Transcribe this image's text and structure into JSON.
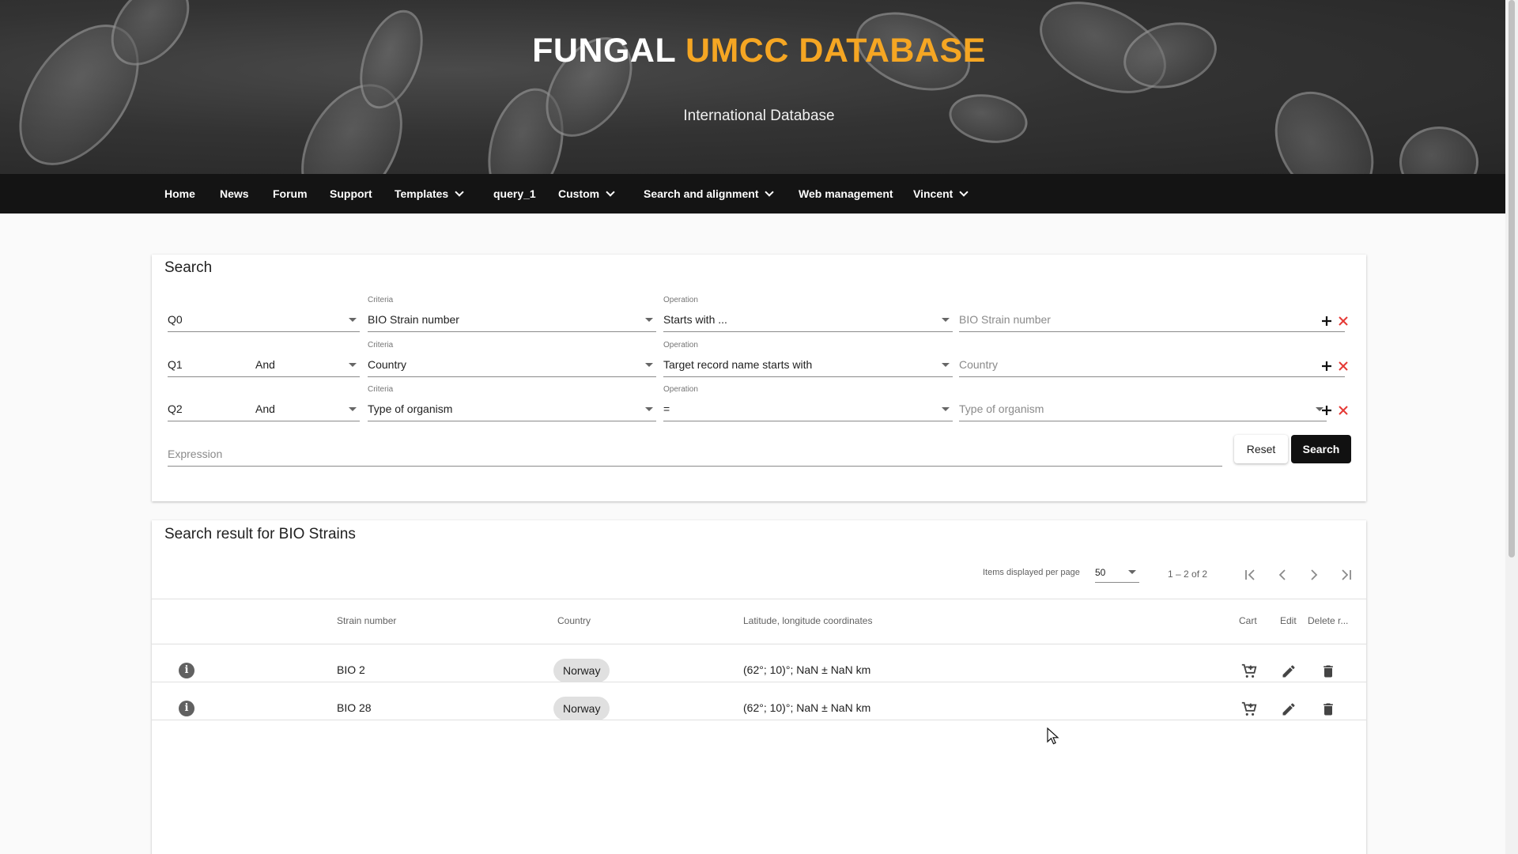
{
  "header": {
    "title_white": "FUNGAL",
    "title_orange": "UMCC DATABASE",
    "subtitle": "International Database",
    "accent_color": "#f5a623"
  },
  "nav": {
    "items": [
      {
        "label": "Home",
        "dropdown": false
      },
      {
        "label": "News",
        "dropdown": false
      },
      {
        "label": "Forum",
        "dropdown": false
      },
      {
        "label": "Support",
        "dropdown": false
      },
      {
        "label": "Templates",
        "dropdown": true
      },
      {
        "label": "query_1",
        "dropdown": false
      },
      {
        "label": "Custom",
        "dropdown": true
      },
      {
        "label": "Search and alignment",
        "dropdown": true
      },
      {
        "label": "Web management",
        "dropdown": false
      },
      {
        "label": "Vincent",
        "dropdown": true
      }
    ]
  },
  "search": {
    "title": "Search",
    "criteria_label": "Criteria",
    "operation_label": "Operation",
    "rows": [
      {
        "q": "Q0",
        "logic": "",
        "criteria": "BIO Strain number",
        "operation": "Starts with ...",
        "value_placeholder": "BIO Strain number"
      },
      {
        "q": "Q1",
        "logic": "And",
        "criteria": "Country",
        "operation": "Target record name starts with",
        "value_placeholder": "Country"
      },
      {
        "q": "Q2",
        "logic": "And",
        "criteria": "Type of organism",
        "operation": "=",
        "value_placeholder": "Type of organism"
      }
    ],
    "expression_placeholder": "Expression",
    "reset_label": "Reset",
    "search_label": "Search"
  },
  "results": {
    "title": "Search result for BIO Strains",
    "items_per_page_label": "Items displayed per page",
    "items_per_page_value": "50",
    "range_label": "1 – 2 of 2",
    "columns": {
      "strain": "Strain number",
      "country": "Country",
      "coords": "Latitude, longitude coordinates",
      "cart": "Cart",
      "edit": "Edit",
      "delete": "Delete r..."
    },
    "rows": [
      {
        "strain": "BIO 2",
        "country": "Norway",
        "coords": "(62°; 10)°; NaN ± NaN km"
      },
      {
        "strain": "BIO 28",
        "country": "Norway",
        "coords": "(62°; 10)°; NaN ± NaN km"
      }
    ]
  }
}
